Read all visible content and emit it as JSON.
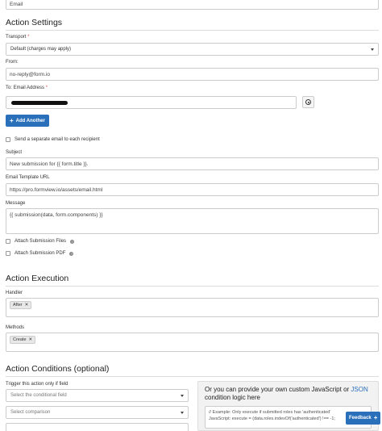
{
  "top_field": {
    "value": "Email"
  },
  "action_settings": {
    "heading": "Action Settings",
    "transport": {
      "label": "Transport",
      "required_mark": "*",
      "value": "Default (charges may apply)"
    },
    "from": {
      "label": "From:",
      "value": "no-reply@form.io"
    },
    "to": {
      "label": "To: Email Address",
      "required_mark": "*",
      "add_button": "Add Another"
    },
    "separate_email": {
      "label": "Send a separate email to each recipient"
    },
    "subject": {
      "label": "Subject",
      "value": "New submission for {{ form.title }}."
    },
    "template": {
      "label": "Email Template URL",
      "value": "https://pro.formview.io/assets/email.html"
    },
    "message": {
      "label": "Message",
      "value": "{{ submission(data, form.components) }}"
    },
    "attach_files": {
      "label": "Attach Submission Files"
    },
    "attach_pdf": {
      "label": "Attach Submission PDF"
    }
  },
  "action_execution": {
    "heading": "Action Execution",
    "handler": {
      "label": "Handler",
      "tag": "After"
    },
    "methods": {
      "label": "Methods",
      "tag": "Create"
    }
  },
  "action_conditions": {
    "heading": "Action Conditions (optional)",
    "trigger_label": "Trigger this action only if field",
    "conditional_placeholder": "Select the conditional field",
    "comparison_placeholder": "Select comparison",
    "custom_title_prefix": "Or you can provide your own custom JavaScript or ",
    "custom_title_link": "JSON",
    "custom_title_suffix": "condition logic here",
    "code_line1": "// Example: Only execute if submitted roles has 'authenticated'",
    "code_line2": "JavaScript: execute = (data.roles.indexOf('authenticated') !== -1;"
  },
  "feedback_button": "Feedback",
  "colors": {
    "primary": "#2a6fba",
    "required": "#d9534f",
    "link": "#2a6fba"
  }
}
